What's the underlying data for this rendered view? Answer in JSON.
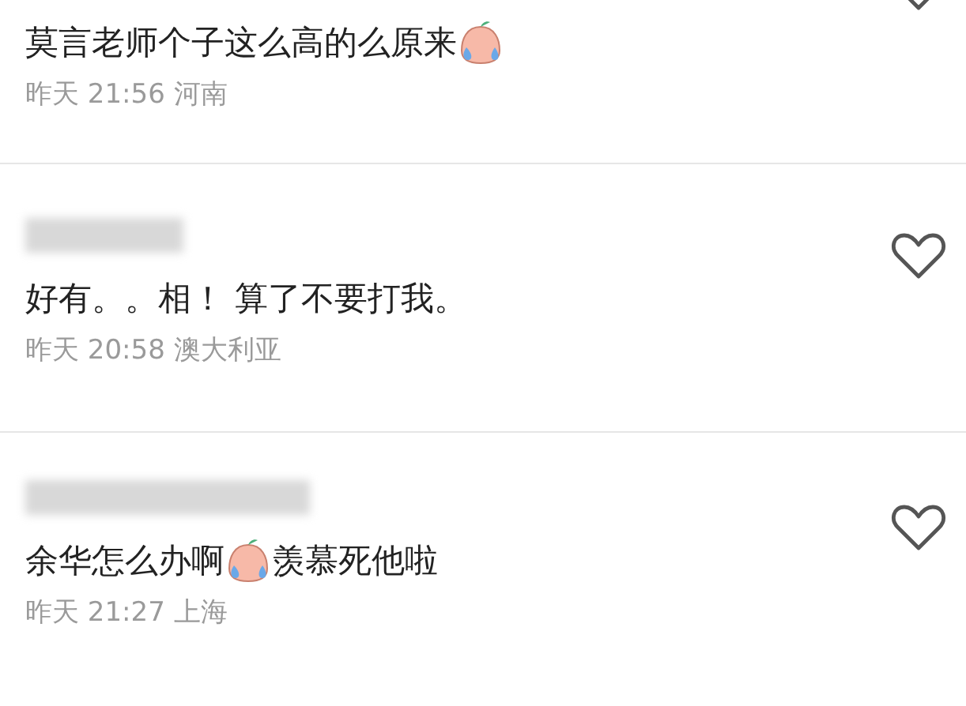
{
  "comments": [
    {
      "liked": false,
      "content": [
        {
          "kind": "text",
          "text": "莫言老师个子这么高的么原来"
        },
        {
          "kind": "emoji"
        }
      ],
      "time": "昨天 21:56",
      "location": "河南"
    },
    {
      "username_blurred": true,
      "liked": false,
      "content": [
        {
          "kind": "text",
          "text": "好有。。相！ 算了不要打我。"
        }
      ],
      "time": "昨天 20:58",
      "location": "澳大利亚"
    },
    {
      "username_blurred": true,
      "liked": false,
      "content": [
        {
          "kind": "text",
          "text": "余华怎么办啊"
        },
        {
          "kind": "emoji"
        },
        {
          "kind": "text",
          "text": "羡慕死他啦"
        }
      ],
      "time": "昨天 21:27",
      "location": "上海"
    }
  ]
}
